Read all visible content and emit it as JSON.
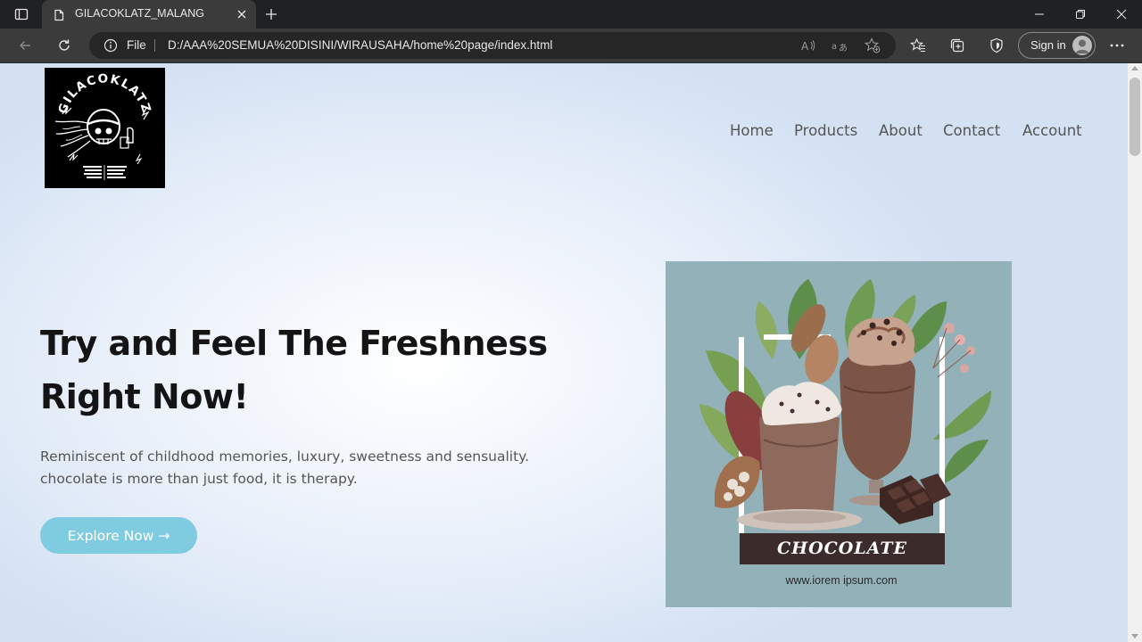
{
  "browser": {
    "tab_title": "GILACOKLATZ_MALANG",
    "address_scheme": "File",
    "address_url": "D:/AAA%20SEMUA%20DISINI/WIRAUSAHA/home%20page/index.html",
    "signin_label": "Sign in"
  },
  "site": {
    "logo_text": "GILACOKLATZ",
    "nav": [
      "Home",
      "Products",
      "About",
      "Contact",
      "Account"
    ],
    "hero_title_line1": "Try and Feel The Freshness",
    "hero_title_line2": "Right Now!",
    "hero_subtitle_line1": "Reminiscent of childhood memories, luxury, sweetness and sensuality.",
    "hero_subtitle_line2": "chocolate is more than just food, it is therapy.",
    "cta_label": "Explore Now →",
    "poster_title": "CHOCOLATE",
    "poster_url": "www.iorem ipsum.com"
  },
  "colors": {
    "cta": "#7fcbe0",
    "poster_bg": "#93b1b8",
    "poster_band": "#3c2b2b",
    "page_bg": "#e9f0fa"
  },
  "icons": [
    "tab-actions-icon",
    "page-favicon-icon",
    "close-icon",
    "plus-icon",
    "minimize-icon",
    "restore-icon",
    "window-close-icon",
    "back-icon",
    "refresh-icon",
    "info-icon",
    "read-aloud-icon",
    "translate-icon",
    "add-favorite-icon",
    "favorites-icon",
    "collections-icon",
    "shield-icon",
    "profile-icon",
    "more-icon"
  ]
}
